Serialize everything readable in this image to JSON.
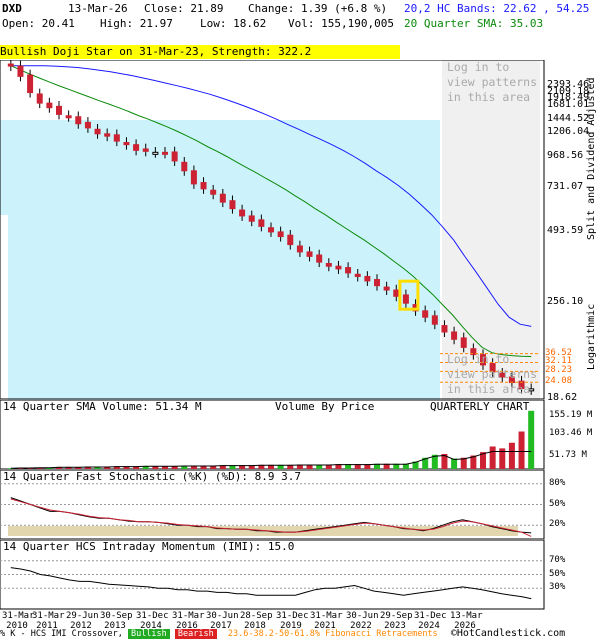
{
  "header": {
    "symbol": "DXD",
    "date": "13-Mar-26",
    "close": "Close: 21.89",
    "change": "Change: 1.39 (+6.8 %)",
    "open": "Open: 20.41",
    "high": "High: 21.97",
    "low": "Low: 18.62",
    "vol": "Vol: 155,190,005",
    "bands": "20,2 HC Bands: 22.62 , 54.25",
    "sma": "20 Quarter SMA: 35.03"
  },
  "signal": "Bullish Doji Star on 31-Mar-23, Strength: 322.2",
  "watermark_top": "Log in to view patterns in this area",
  "watermark_bottom": "Log in to view patterns in this area",
  "right_axis_title": "Split and Dividend Adjusted",
  "right_axis_scale": "Logarithmic",
  "price_axis": [
    "2393.46",
    "2109.18",
    "1918.49",
    "1681.01",
    "1444.52",
    "1206.04",
    "968.56",
    "731.07",
    "493.59",
    "256.10",
    "18.62"
  ],
  "fib_levels": [
    "36.52",
    "32.11",
    "28.23",
    "24.08"
  ],
  "volume": {
    "title": "14 Quarter SMA Volume: 51.34 M",
    "center": "Volume By Price",
    "right": "QUARTERLY CHART",
    "axis": [
      "155.19 M",
      "103.46 M",
      "51.73 M"
    ]
  },
  "stochastic": {
    "title": "14 Quarter Fast Stochastic (%K) (%D): 8.9   3.7",
    "axis": [
      "80%",
      "50%",
      "20%"
    ]
  },
  "momentum": {
    "title": "14 Quarter HCS Intraday Momentum (IMI): 15.0",
    "axis": [
      "70%",
      "50%",
      "30%"
    ]
  },
  "footer": {
    "prefix": "% K - HCS IMI Crossover,",
    "bull": "Bullish",
    "bear": "Bearish",
    "fib": "23.6-38.2-50-61.8% Fibonacci Retracements",
    "copy": "©HotCandlestick.com"
  },
  "colors": {
    "up": "#22bb22",
    "down": "#cc2233",
    "sma20": "#0a8a0a",
    "band": "#1a1aff",
    "fib": "#ff8800",
    "cyan": "#ccf3fb"
  },
  "chart_data": {
    "type": "candlestick",
    "x": [
      "31-Mar-2010",
      "31-Mar-2011",
      "29-Jun-2012",
      "30-Sep-2013",
      "31-Dec-2014",
      "31-Mar-2016",
      "30-Jun-2017",
      "28-Sep-2018",
      "31-Dec-2019",
      "31-Mar-2021",
      "30-Jun-2022",
      "29-Sep-2023",
      "31-Dec-2024",
      "13-Mar-2026"
    ],
    "closes": [
      2380,
      2050,
      1620,
      1390,
      1300,
      1180,
      1140,
      1030,
      970,
      890,
      860,
      800,
      760,
      700,
      690,
      680,
      670,
      600,
      520,
      430,
      400,
      370,
      330,
      300,
      270,
      250,
      232,
      214,
      200,
      178,
      160,
      150,
      138,
      130,
      125,
      118,
      112,
      105,
      98,
      92,
      84,
      76,
      68,
      62,
      56,
      50,
      45,
      40,
      36,
      31,
      28,
      26,
      24,
      22,
      21.89
    ],
    "sma20": [
      2393,
      2250,
      2110,
      1990,
      1880,
      1780,
      1690,
      1600,
      1520,
      1440,
      1370,
      1300,
      1230,
      1160,
      1100,
      1040,
      980,
      920,
      860,
      800,
      740,
      690,
      640,
      590,
      545,
      505,
      465,
      430,
      395,
      360,
      330,
      300,
      275,
      250,
      228,
      208,
      190,
      172,
      156,
      140,
      126,
      112,
      98,
      86,
      74,
      64,
      54,
      46,
      40,
      37,
      36,
      35.5,
      35.2,
      35.03
    ],
    "upper_band": [
      2393,
      2393,
      2393,
      2390,
      2380,
      2360,
      2330,
      2290,
      2240,
      2190,
      2130,
      2070,
      2000,
      1930,
      1860,
      1790,
      1720,
      1650,
      1580,
      1500,
      1420,
      1340,
      1260,
      1180,
      1100,
      1020,
      950,
      880,
      820,
      760,
      700,
      640,
      580,
      520,
      470,
      420,
      370,
      320,
      275,
      230,
      190,
      150,
      120,
      95,
      75,
      62,
      56,
      54.25
    ],
    "ylim": [
      18.62,
      2393.46
    ],
    "volume_series_label": "14 Quarter SMA Volume",
    "volume": [
      2,
      3,
      3,
      4,
      4,
      5,
      5,
      5,
      6,
      6,
      6,
      7,
      7,
      7,
      8,
      8,
      8,
      8,
      9,
      9,
      9,
      9,
      10,
      10,
      10,
      10,
      11,
      11,
      11,
      11,
      12,
      12,
      12,
      12,
      13,
      13,
      13,
      13,
      14,
      14,
      14,
      14,
      20,
      30,
      38,
      40,
      28,
      30,
      36,
      45,
      60,
      55,
      70,
      100,
      155.19
    ],
    "volume_up": [
      true,
      false,
      false,
      false,
      true,
      false,
      false,
      false,
      false,
      true,
      false,
      false,
      false,
      false,
      true,
      false,
      false,
      false,
      true,
      false,
      false,
      false,
      false,
      true,
      false,
      false,
      false,
      false,
      true,
      false,
      false,
      false,
      true,
      false,
      false,
      true,
      false,
      false,
      true,
      false,
      true,
      true,
      true,
      true,
      true,
      false,
      true,
      false,
      false,
      false,
      false,
      false,
      false,
      false,
      true
    ],
    "stochastic_k": [
      60,
      55,
      50,
      45,
      40,
      40,
      38,
      35,
      32,
      30,
      30,
      28,
      26,
      25,
      25,
      24,
      22,
      20,
      20,
      18,
      18,
      15,
      15,
      14,
      14,
      12,
      12,
      10,
      10,
      10,
      12,
      14,
      16,
      18,
      20,
      22,
      24,
      22,
      20,
      18,
      15,
      14,
      12,
      15,
      20,
      25,
      28,
      25,
      22,
      18,
      15,
      12,
      10,
      8.9
    ],
    "stochastic_d": [
      58,
      54,
      50,
      46,
      42,
      40,
      38,
      36,
      33,
      31,
      30,
      28,
      27,
      25,
      25,
      24,
      23,
      21,
      20,
      19,
      18,
      16,
      15,
      14,
      14,
      13,
      12,
      11,
      10,
      10,
      11,
      13,
      15,
      17,
      19,
      21,
      23,
      22,
      20,
      18,
      16,
      14,
      13,
      14,
      18,
      23,
      26,
      25,
      22,
      19,
      16,
      13,
      10,
      3.7
    ],
    "imi": [
      60,
      58,
      55,
      50,
      48,
      45,
      42,
      40,
      40,
      38,
      36,
      35,
      34,
      33,
      32,
      30,
      30,
      28,
      28,
      26,
      26,
      24,
      24,
      22,
      22,
      20,
      20,
      20,
      20,
      20,
      24,
      28,
      30,
      30,
      32,
      34,
      30,
      26,
      24,
      22,
      20,
      22,
      24,
      26,
      28,
      30,
      32,
      30,
      28,
      25,
      22,
      20,
      18,
      15.0
    ]
  }
}
